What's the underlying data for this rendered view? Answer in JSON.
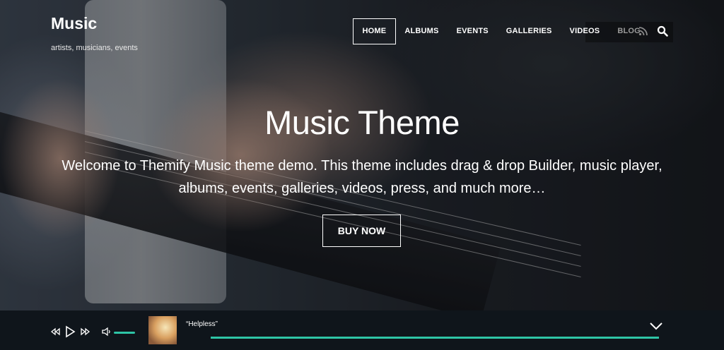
{
  "site": {
    "title": "Music",
    "tagline": "artists, musicians, events"
  },
  "nav": {
    "items": [
      "HOME",
      "ALBUMS",
      "EVENTS",
      "GALLERIES",
      "VIDEOS",
      "BLOG"
    ],
    "active": "HOME",
    "icons": [
      "rss-icon",
      "search-icon"
    ]
  },
  "hero": {
    "title": "Music Theme",
    "text_line1": "Welcome to Themify Music theme demo. This theme includes drag & drop Builder, music player,",
    "text_line2": "albums, events, galleries, videos, press, and much more…",
    "button_label": "BUY NOW"
  },
  "player": {
    "track_title": "“Helpless”",
    "controls": [
      "previous-icon",
      "play-icon",
      "next-icon",
      "volume-icon",
      "chevron-down-icon"
    ],
    "accent_color": "#2ec4a6"
  }
}
